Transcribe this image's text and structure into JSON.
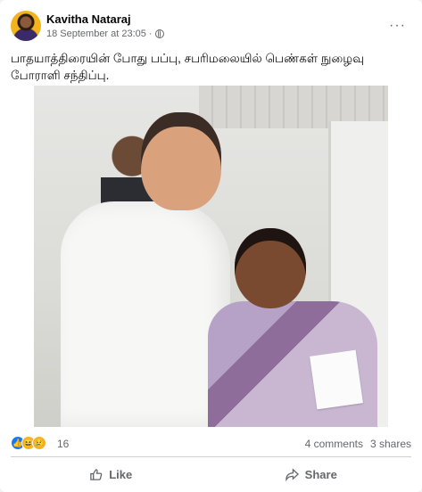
{
  "post": {
    "author": "Kavitha Nataraj",
    "timestamp": "18 September at 23:05",
    "separator": "·",
    "privacy_icon": "globe-icon",
    "more_icon": "more-options-icon",
    "more_label": "···",
    "caption": "பாதயாத்திரையின் போது பப்பு, சபரிமலையில் பெண்கள் நுழைவு போராளி சந்திப்பு."
  },
  "engagement": {
    "reaction_icons": [
      "like-reaction-icon",
      "haha-reaction-icon",
      "sad-reaction-icon"
    ],
    "reaction_count": "16",
    "comments": "4 comments",
    "shares": "3 shares"
  },
  "actions": {
    "like": {
      "label": "Like",
      "icon": "thumbs-up-icon"
    },
    "share": {
      "label": "Share",
      "icon": "share-arrow-icon"
    }
  },
  "colors": {
    "like_blue": "#1877f2",
    "secondary_text": "#65676b",
    "background": "#f0f2f5"
  }
}
